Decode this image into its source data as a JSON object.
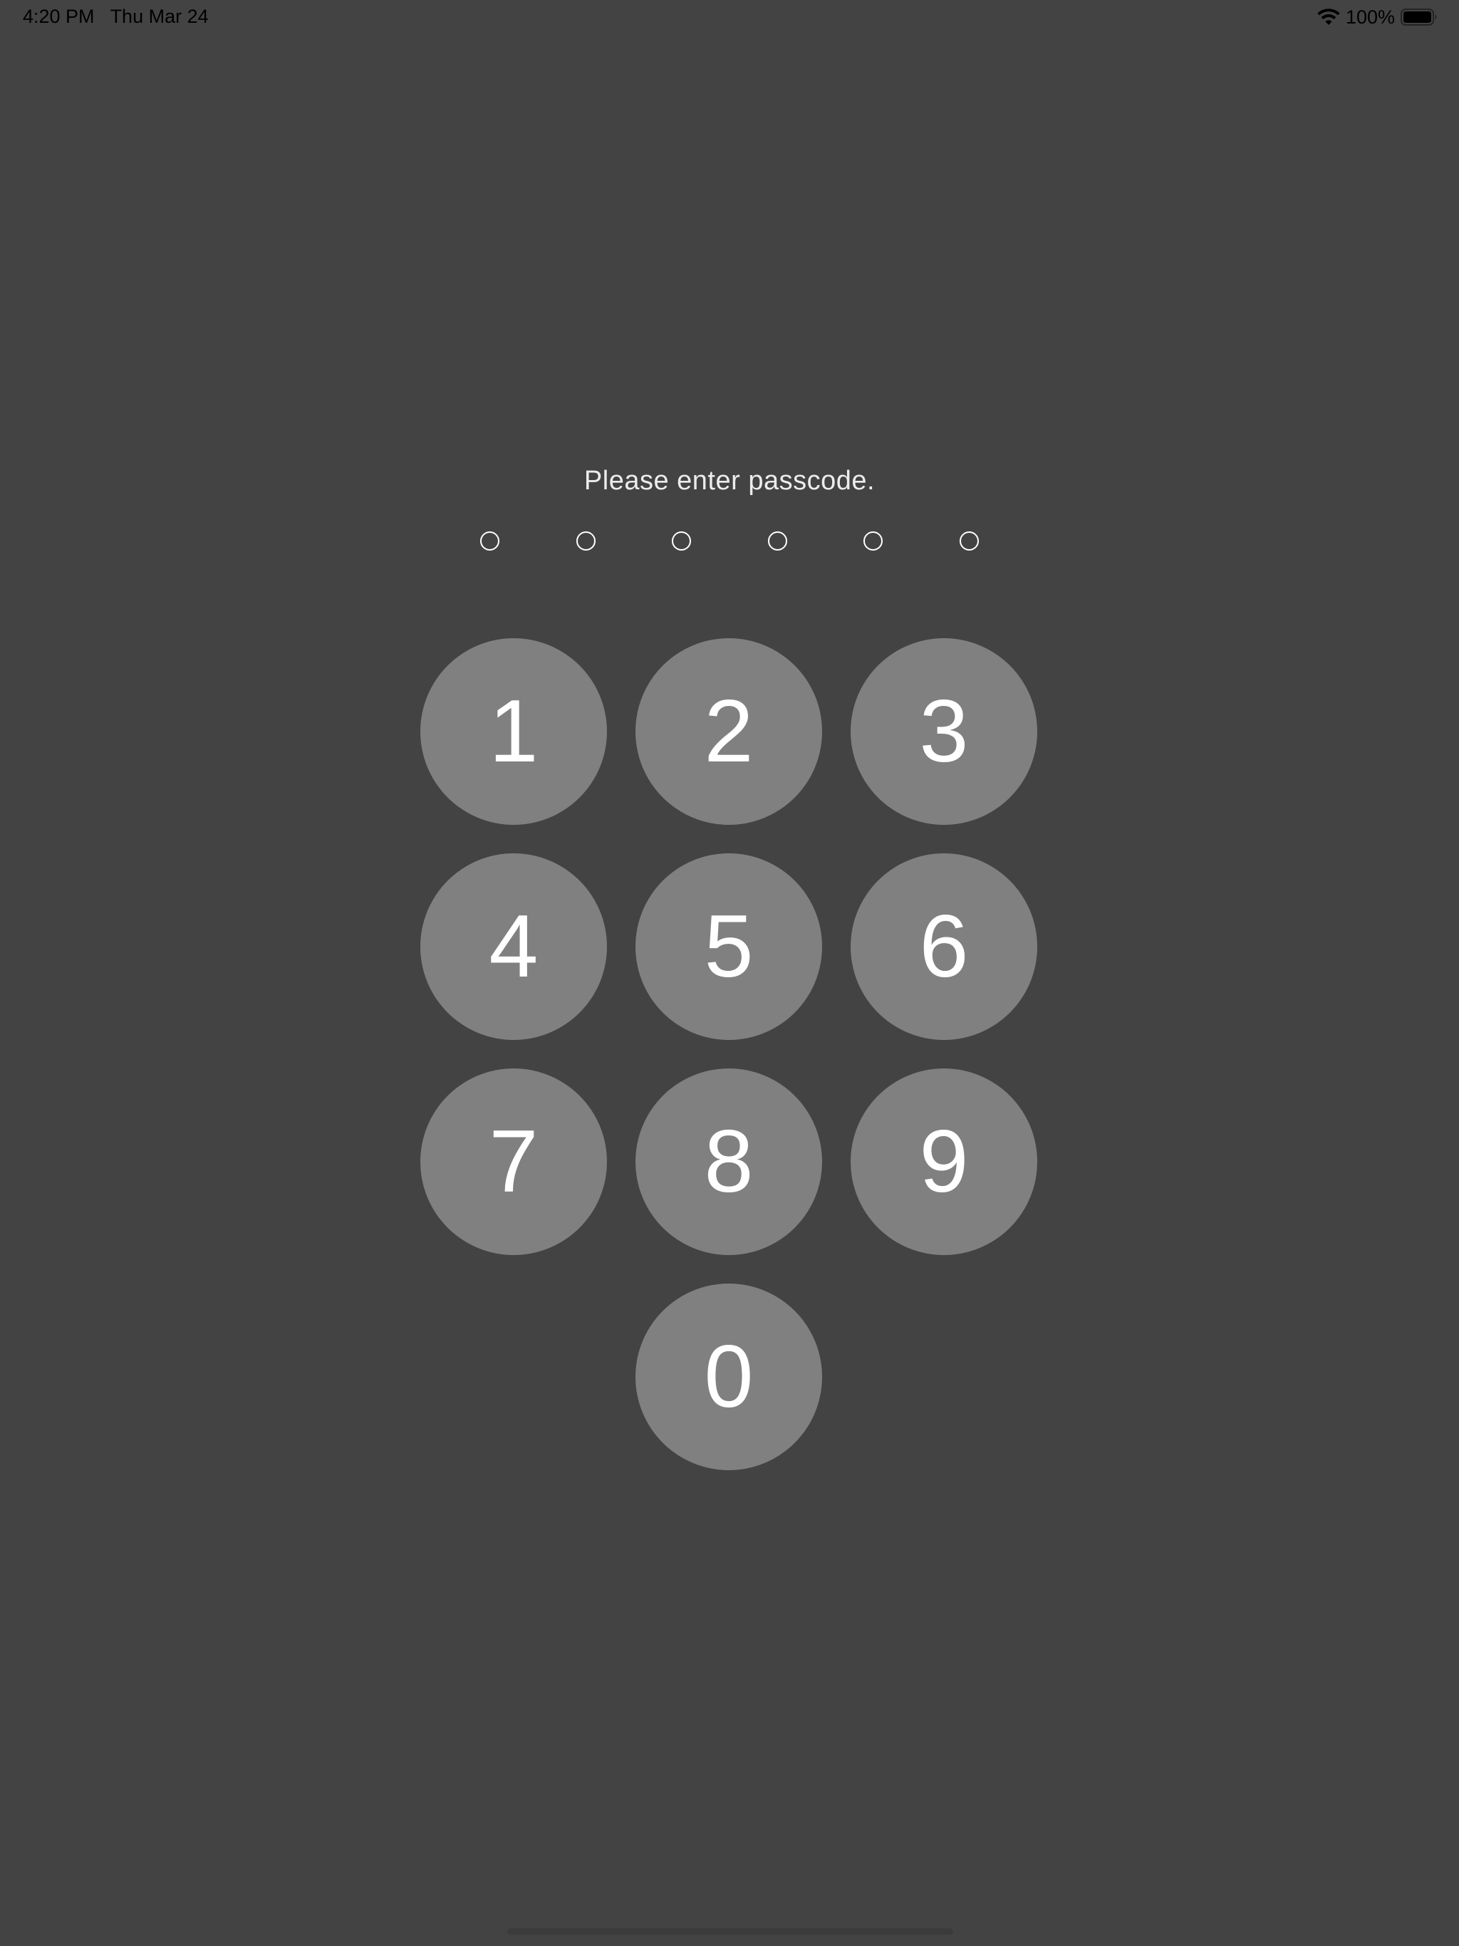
{
  "status_bar": {
    "time": "4:20 PM",
    "date": "Thu Mar 24",
    "battery_percent": "100%",
    "battery_level": 1.0,
    "icons": [
      "wifi-icon",
      "battery-icon"
    ]
  },
  "passcode": {
    "prompt": "Please enter passcode.",
    "length": 6,
    "entered": 0
  },
  "keypad": {
    "keys": [
      "1",
      "2",
      "3",
      "4",
      "5",
      "6",
      "7",
      "8",
      "9",
      "0"
    ]
  },
  "colors": {
    "background": "#434343",
    "key": "#808080",
    "text": "#ffffff"
  }
}
